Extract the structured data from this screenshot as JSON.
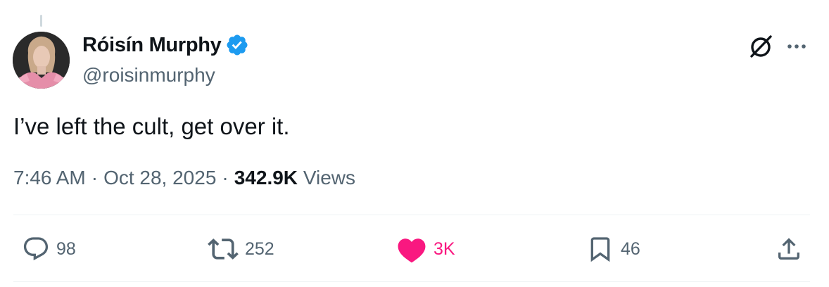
{
  "tweet": {
    "author": {
      "display_name": "Róisín Murphy",
      "handle": "@roisinmurphy",
      "verified": true
    },
    "text": "I’ve left the cult, get over it.",
    "time": "7:46 AM",
    "separator": "·",
    "date": "Oct 28, 2025",
    "views_count": "342.9K",
    "views_label": "Views"
  },
  "actions": {
    "replies": "98",
    "reposts": "252",
    "likes": "3K",
    "bookmarks": "46"
  },
  "icons": {
    "verified": "verified-badge-icon",
    "grok": "grok-icon",
    "more": "more-icon",
    "reply": "reply-icon",
    "repost": "repost-icon",
    "like": "heart-icon",
    "bookmark": "bookmark-icon",
    "share": "share-icon"
  },
  "colors": {
    "text": "#0f1419",
    "secondary": "#536471",
    "verified": "#1d9bf0",
    "like": "#f91880",
    "divider": "#eff3f4"
  }
}
